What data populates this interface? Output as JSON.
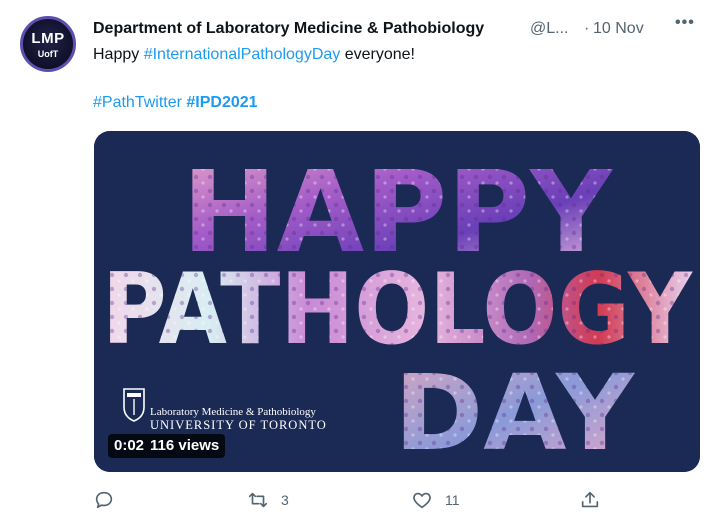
{
  "avatar": {
    "line1": "LMP",
    "line2": "UofT"
  },
  "tweet": {
    "display_name": "Department of Laboratory Medicine & Pathobiology",
    "handle": "@L...",
    "separator": "·",
    "date": "10 Nov",
    "more_label": "•••",
    "text_prefix": "Happy ",
    "hashtag1": "#InternationalPathologyDay",
    "text_suffix": " everyone!",
    "hashtag2": "#PathTwitter",
    "hashtag3": "#IPD2021"
  },
  "media": {
    "line1": "HAPPY",
    "line2": "PATHOLOGY",
    "line3": "DAY",
    "logo_line1": "Laboratory Medicine & Pathobiology",
    "logo_line2": "UNIVERSITY OF TORONTO",
    "video_time": "0:02",
    "video_views": "116 views",
    "background_color": "#1a2a55"
  },
  "actions": {
    "reply_count": "",
    "retweet_count": "3",
    "like_count": "11",
    "share_count": ""
  },
  "colors": {
    "link": "#1d9bf0",
    "muted": "#536471",
    "text": "#0f1419"
  }
}
